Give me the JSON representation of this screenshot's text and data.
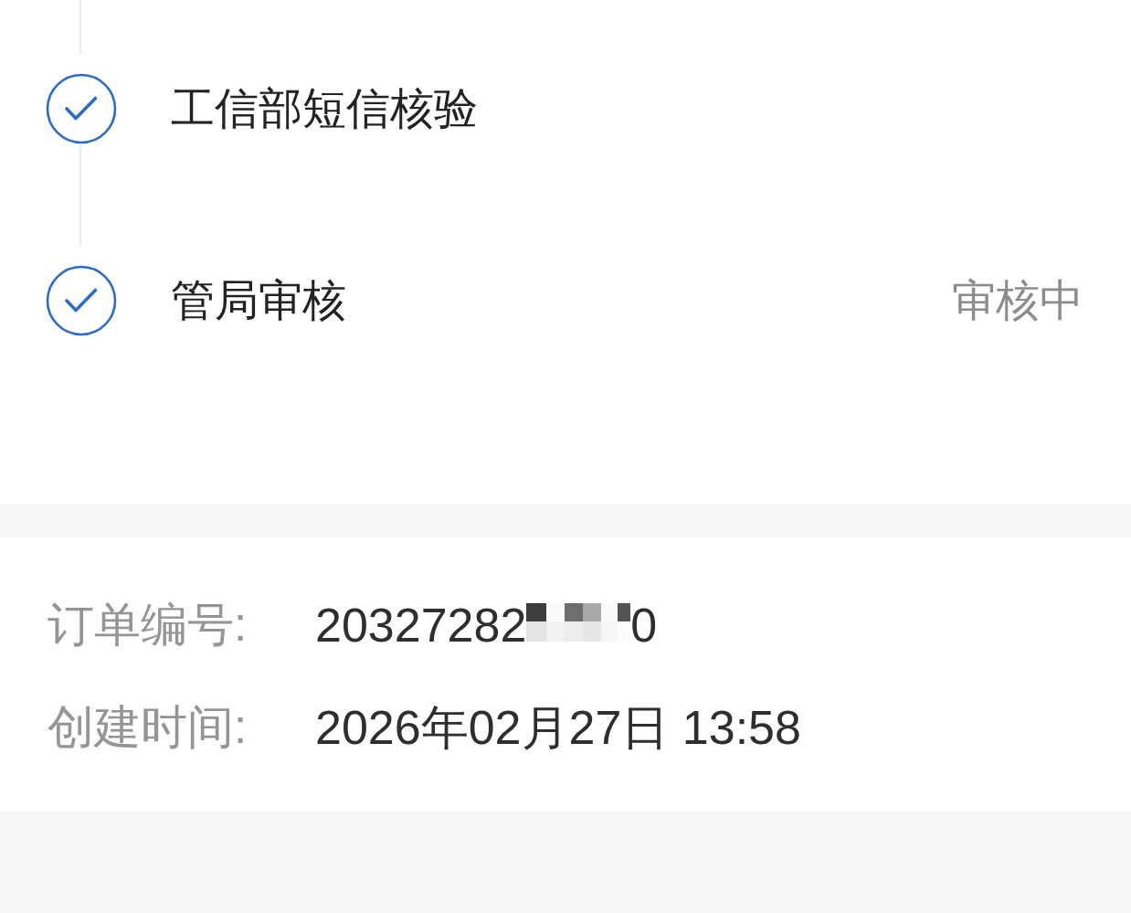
{
  "timeline": {
    "steps": [
      {
        "title": "工信部短信核验",
        "done": true
      },
      {
        "title": "管局审核",
        "done": true,
        "status": "审核中"
      }
    ]
  },
  "order_info": {
    "fields": [
      {
        "label": "订单编号:",
        "value": "20327282",
        "redacted": true,
        "value_tail": "0"
      },
      {
        "label": "创建时间:",
        "value": "2026年02月27日 13:58",
        "redacted": false
      }
    ]
  }
}
